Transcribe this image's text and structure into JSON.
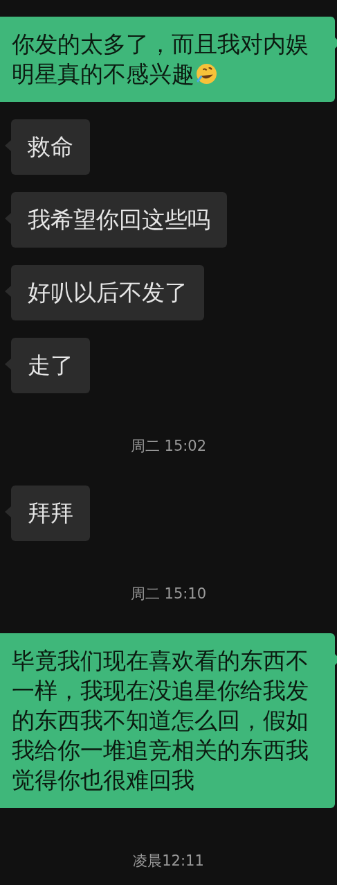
{
  "messages": [
    {
      "kind": "sent",
      "text": "你发的太多了，而且我对内娱明星真的不感兴趣",
      "emoji": true
    },
    {
      "kind": "received",
      "text": "救命"
    },
    {
      "kind": "received",
      "text": "我希望你回这些吗"
    },
    {
      "kind": "received",
      "text": "好叭以后不发了"
    },
    {
      "kind": "received",
      "text": "走了"
    },
    {
      "kind": "time",
      "text": "周二 15:02"
    },
    {
      "kind": "received",
      "text": "拜拜"
    },
    {
      "kind": "time",
      "text": "周二 15:10"
    },
    {
      "kind": "sent",
      "text": "毕竟我们现在喜欢看的东西不一样，我现在没追星你给我发的东西我不知道怎么回，假如我给你一堆追竞相关的东西我觉得你也很难回我"
    },
    {
      "kind": "time",
      "text": "凌晨12:11"
    }
  ]
}
